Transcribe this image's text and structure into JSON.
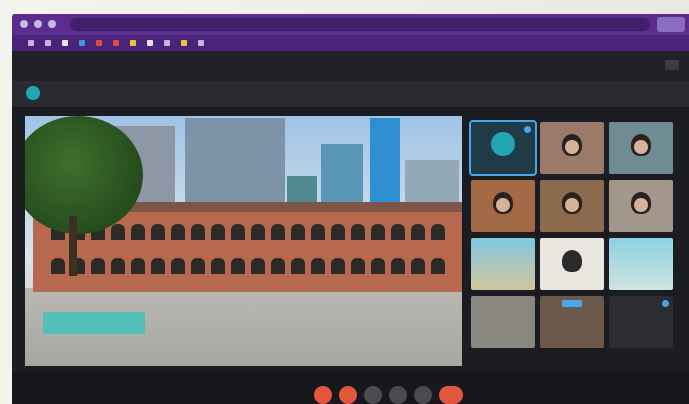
{
  "browser": {
    "address_text": "",
    "bookmarks": [
      "",
      "",
      "",
      "",
      "",
      "",
      "",
      "",
      "",
      "",
      ""
    ]
  },
  "meeting": {
    "title": "",
    "presenter_name": "",
    "caption_text": ""
  },
  "participants": [
    {
      "kind": "logo",
      "label": "",
      "active": true
    },
    {
      "kind": "person"
    },
    {
      "kind": "person"
    },
    {
      "kind": "person"
    },
    {
      "kind": "person"
    },
    {
      "kind": "person"
    },
    {
      "kind": "image"
    },
    {
      "kind": "cartoon"
    },
    {
      "kind": "image"
    },
    {
      "kind": "room"
    },
    {
      "kind": "room"
    },
    {
      "kind": "dark"
    }
  ],
  "bottom_bar": {
    "info_text": ""
  },
  "controls": [
    {
      "icon": "mic-muted-icon"
    },
    {
      "icon": "camera-off-icon"
    },
    {
      "icon": "raise-hand-icon"
    },
    {
      "icon": "captions-icon"
    },
    {
      "icon": "more-options-icon"
    },
    {
      "icon": "leave-call-icon"
    }
  ],
  "colors": {
    "browser_chrome": "#5b2d8e",
    "accent": "#23a6b3",
    "end_call": "#e2563b",
    "active_outline": "#4aa6e8"
  }
}
